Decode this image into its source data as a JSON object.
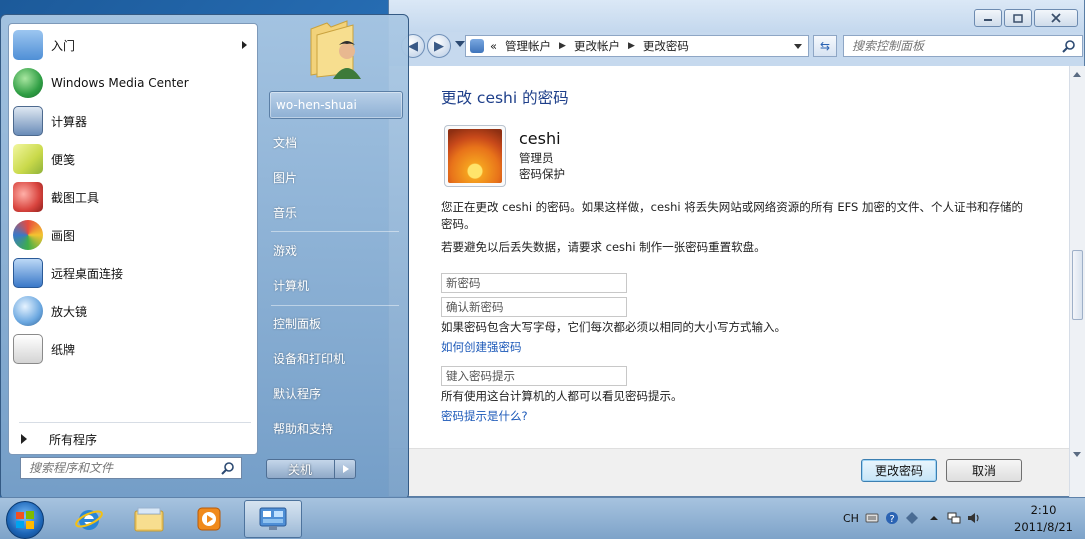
{
  "control_panel": {
    "breadcrumb": [
      "«",
      "管理帐户",
      "更改帐户",
      "更改密码"
    ],
    "search_placeholder": "搜索控制面板",
    "page_title": "更改 ceshi 的密码",
    "user": {
      "name": "ceshi",
      "role": "管理员",
      "protection": "密码保护"
    },
    "warning_text": "您正在更改 ceshi 的密码。如果这样做，ceshi 将丢失网站或网络资源的所有 EFS 加密的文件、个人证书和存储的密码。",
    "reset_disk_text": "若要避免以后丢失数据，请要求 ceshi 制作一张密码重置软盘。",
    "new_password_placeholder": "新密码",
    "confirm_password_placeholder": "确认新密码",
    "case_hint": "如果密码包含大写字母，它们每次都必须以相同的大小写方式输入。",
    "strong_password_link": "如何创建强密码",
    "hint_placeholder": "键入密码提示",
    "hint_visible_text": "所有使用这台计算机的人都可以看见密码提示。",
    "hint_what_link": "密码提示是什么?",
    "change_button": "更改密码",
    "cancel_button": "取消"
  },
  "start_menu": {
    "programs": [
      {
        "label": "入门",
        "icon": "getting-started-icon",
        "color": "#4f8fd6",
        "has_submenu": true
      },
      {
        "label": "Windows Media Center",
        "icon": "media-center-icon",
        "color": "#2f9e44",
        "has_submenu": false
      },
      {
        "label": "计算器",
        "icon": "calculator-icon",
        "color": "#6a8cb8",
        "has_submenu": false
      },
      {
        "label": "便笺",
        "icon": "sticky-notes-icon",
        "color": "#c9d94a",
        "has_submenu": false
      },
      {
        "label": "截图工具",
        "icon": "snipping-tool-icon",
        "color": "#d9453f",
        "has_submenu": false
      },
      {
        "label": "画图",
        "icon": "paint-icon",
        "color": "#e89a2c",
        "has_submenu": false
      },
      {
        "label": "远程桌面连接",
        "icon": "remote-desktop-icon",
        "color": "#3a78c8",
        "has_submenu": false
      },
      {
        "label": "放大镜",
        "icon": "magnifier-icon",
        "color": "#6aa7e0",
        "has_submenu": false
      },
      {
        "label": "纸牌",
        "icon": "solitaire-icon",
        "color": "#8a8a8a",
        "has_submenu": false
      }
    ],
    "all_programs": "所有程序",
    "search_placeholder": "搜索程序和文件",
    "user_name": "wo-hen-shuai",
    "right_items": [
      "文档",
      "图片",
      "音乐",
      "游戏",
      "计算机",
      "控制面板",
      "设备和打印机",
      "默认程序",
      "帮助和支持"
    ],
    "shutdown": "关机"
  },
  "taskbar": {
    "language": "CH",
    "time": "2:10",
    "date": "2011/8/21"
  }
}
